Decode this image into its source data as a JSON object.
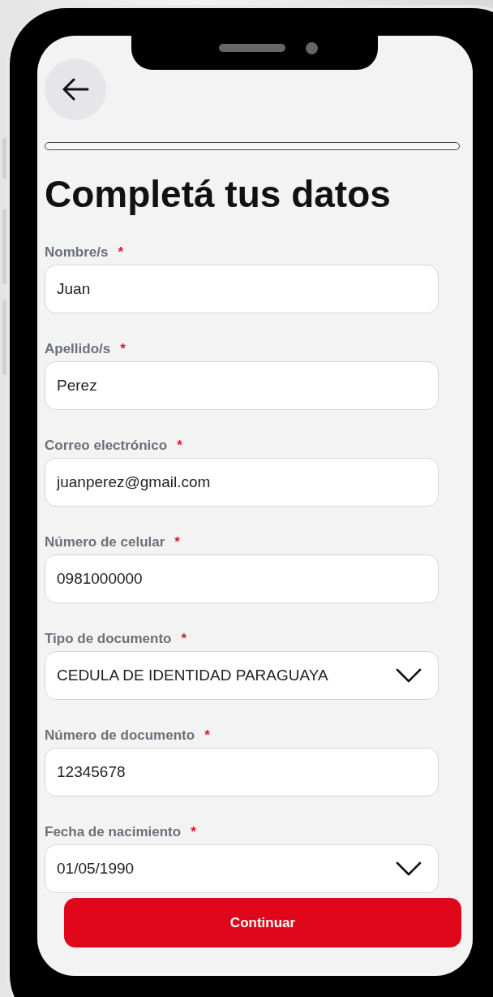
{
  "progress": {
    "level": 0
  },
  "title": "Completá tus datos",
  "fields": [
    {
      "label": "Nombre/s",
      "required_mark": "*",
      "value": "Juan",
      "kind": "text"
    },
    {
      "label": "Apellido/s",
      "required_mark": "*",
      "value": "Perez",
      "kind": "text"
    },
    {
      "label": "Correo electrónico",
      "required_mark": "*",
      "value": "juanperez@gmail.com",
      "kind": "text"
    },
    {
      "label": "Número de celular",
      "required_mark": "*",
      "value": "0981000000",
      "kind": "text"
    },
    {
      "label": "Tipo de documento",
      "required_mark": "*",
      "value": "CEDULA DE IDENTIDAD PARAGUAYA",
      "kind": "select"
    },
    {
      "label": "Número de documento",
      "required_mark": "*",
      "value": "12345678",
      "kind": "text"
    },
    {
      "label": "Fecha de nacimiento",
      "required_mark": "*",
      "value": "01/05/1990",
      "kind": "select"
    }
  ],
  "button": "Continuar"
}
